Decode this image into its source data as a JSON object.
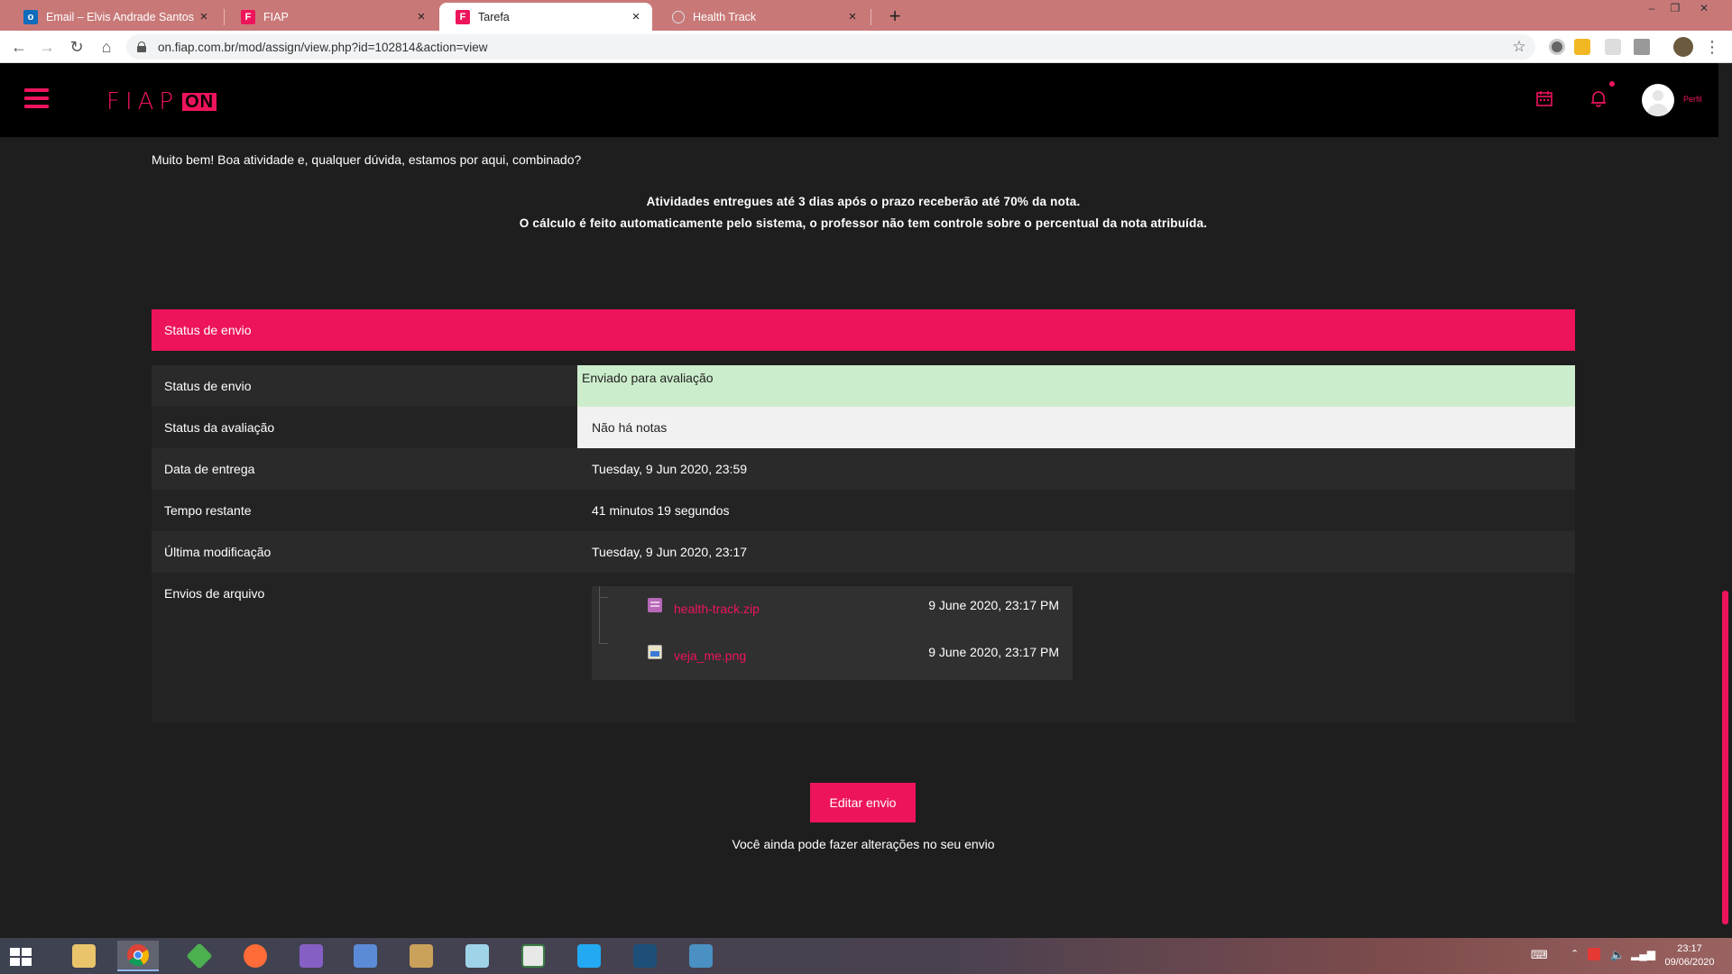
{
  "browser": {
    "tabs": [
      {
        "title": "Email – Elvis Andrade Santos – O",
        "favicon": "outlook-icon",
        "active": false
      },
      {
        "title": "FIAP",
        "favicon": "fiap-icon",
        "active": false
      },
      {
        "title": "Tarefa",
        "favicon": "fiap-icon",
        "active": true
      },
      {
        "title": "Health Track",
        "favicon": "globe-icon",
        "active": false
      }
    ],
    "url": "on.fiap.com.br/mod/assign/view.php?id=102814&action=view"
  },
  "header": {
    "logo_text": "FIAP",
    "logo_suffix": "ON",
    "profile_label": "Perfil",
    "accent_color": "#ed145b"
  },
  "content": {
    "intro": "Muito bem! Boa atividade e, qualquer dúvida, estamos por aqui, combinado?",
    "notice_line1": "Atividades entregues até 3 dias após o prazo receberão até 70% da nota.",
    "notice_line2": "O cálculo é feito automaticamente pelo sistema, o professor não tem controle sobre o percentual da nota atribuída.",
    "status_header": "Status de envio",
    "rows": [
      {
        "label": "Status de envio",
        "value": "Enviado para avaliação"
      },
      {
        "label": "Status da avaliação",
        "value": "Não há notas"
      },
      {
        "label": "Data de entrega",
        "value": "Tuesday, 9 Jun 2020, 23:59"
      },
      {
        "label": "Tempo restante",
        "value": "41 minutos 19 segundos"
      },
      {
        "label": "Última modificação",
        "value": "Tuesday, 9 Jun 2020, 23:17"
      },
      {
        "label": "Envios de arquivo",
        "value": ""
      }
    ],
    "files": [
      {
        "name": "health-track.zip",
        "date": "9 June 2020, 23:17 PM",
        "icon": "archive-icon"
      },
      {
        "name": "veja_me.png",
        "date": "9 June 2020, 23:17 PM",
        "icon": "image-icon"
      }
    ],
    "edit_button": "Editar envio",
    "edit_note": "Você ainda pode fazer alterações no seu envio"
  },
  "taskbar": {
    "time": "23:17",
    "date": "09/06/2020"
  }
}
